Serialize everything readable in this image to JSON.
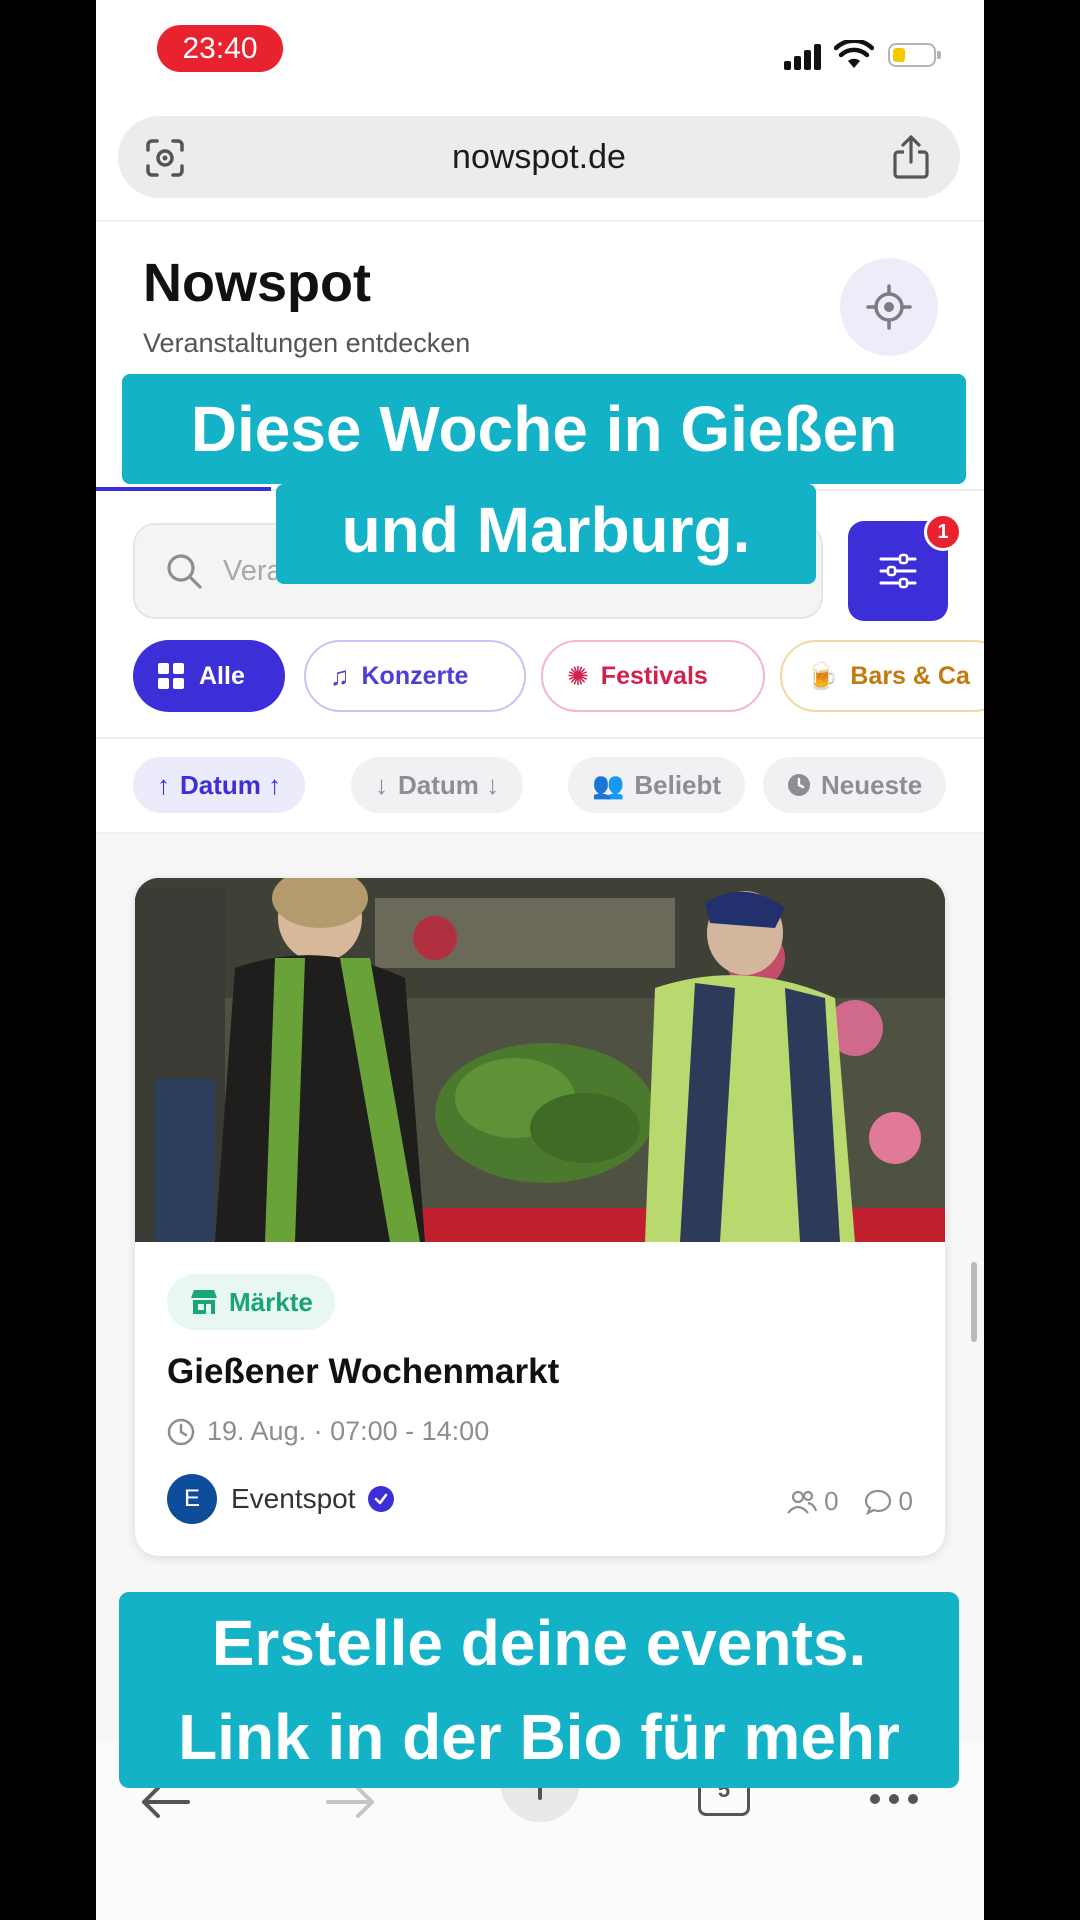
{
  "status_bar": {
    "time": "23:40"
  },
  "browser": {
    "url": "nowspot.de"
  },
  "header": {
    "title": "Nowspot",
    "subtitle": "Veranstaltungen entdecken"
  },
  "search": {
    "placeholder": "Veranstaltungen suchen...",
    "visible_fragment": "Vera",
    "filter_badge": "1"
  },
  "categories": [
    {
      "label": "Alle",
      "icon": "grid-icon",
      "active": true
    },
    {
      "label": "Konzerte",
      "icon": "music-note-icon"
    },
    {
      "label": "Festivals",
      "icon": "festival-icon"
    },
    {
      "label": "Bars & Ca",
      "icon": "beer-mug-icon"
    }
  ],
  "sort": [
    {
      "label": "Datum ↑",
      "icon": "arrow-up-icon",
      "active": true
    },
    {
      "label": "Datum ↓",
      "icon": "arrow-down-icon"
    },
    {
      "label": "Beliebt",
      "icon": "users-icon"
    },
    {
      "label": "Neueste",
      "icon": "clock-icon"
    }
  ],
  "event": {
    "category": "Märkte",
    "title": "Gießener Wochenmarkt",
    "time": "19. Aug. · 07:00 - 14:00",
    "host_initial": "E",
    "host": "Eventspot",
    "attendees": "0",
    "comments": "0"
  },
  "toolbar": {
    "tabs_count": "5"
  },
  "captions": {
    "top_line1": "Diese Woche in Gießen",
    "top_line2": "und Marburg.",
    "bottom_line1": "Erstelle deine events.",
    "bottom_line2": "Link in der Bio für mehr"
  },
  "colors": {
    "accent": "#3d2fd8",
    "caption": "#13b2c7",
    "market_green": "#1aa576",
    "alert_red": "#e8232f"
  }
}
